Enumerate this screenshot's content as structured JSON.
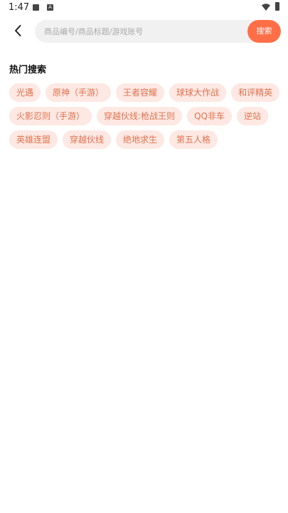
{
  "status_bar": {
    "time": "1:47",
    "icons": [
      "image-icon",
      "a-icon",
      "wifi-icon",
      "battery-icon"
    ]
  },
  "header": {
    "back_icon": "chevron-left-icon",
    "search": {
      "placeholder": "商品编号/商品标题/游戏账号",
      "value": ""
    },
    "search_button_label": "搜索"
  },
  "hot_search": {
    "title": "热门搜索",
    "tags": [
      "光遇",
      "原神（手游）",
      "王者容耀",
      "球球大作战",
      "和评精英",
      "火影忍则（手游）",
      "穿越伙线:枪战王则",
      "QQ非车",
      "逆站",
      "英雄连盟",
      "穿越伙线",
      "绝地求生",
      "第五人格"
    ]
  },
  "colors": {
    "accent": "#ff6f47",
    "tag_background": "#fde8e3",
    "tag_text": "#e0734e",
    "search_background": "#f1f1f1"
  }
}
